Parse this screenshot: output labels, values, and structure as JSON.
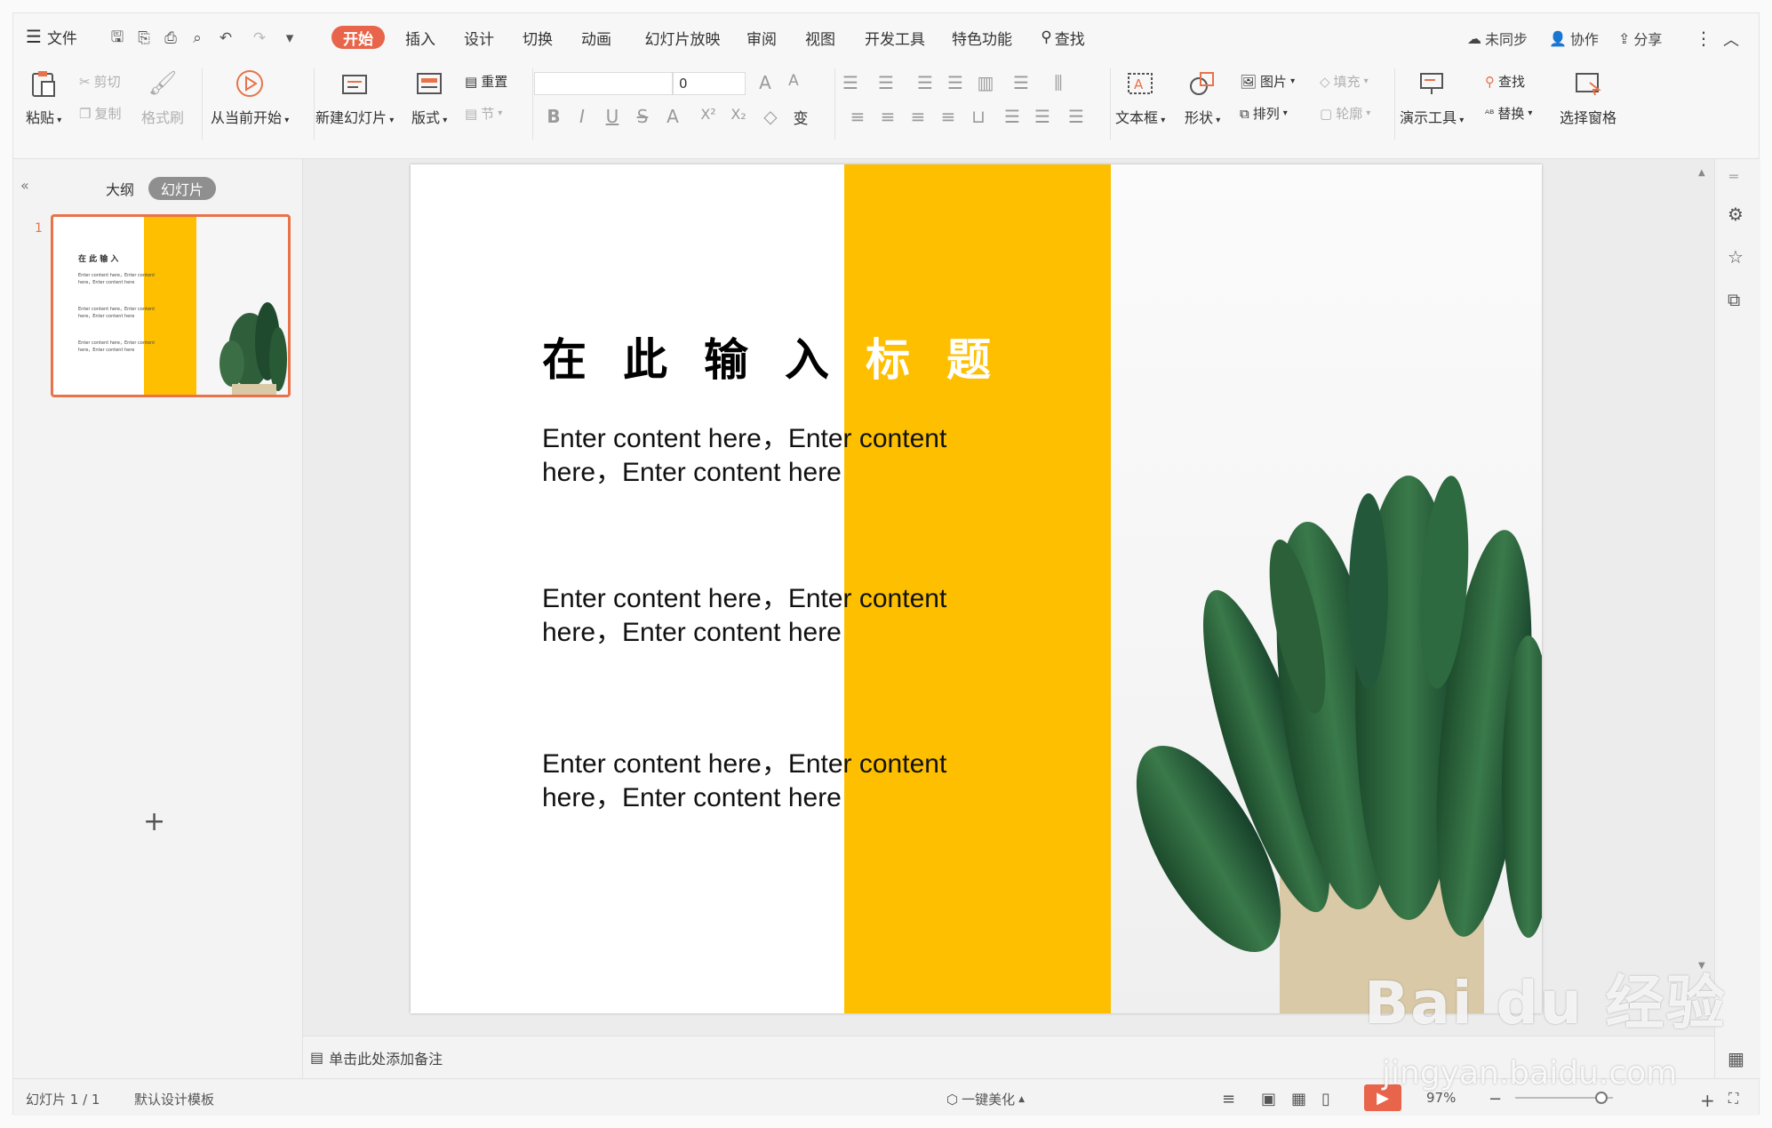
{
  "menu": {
    "file": "文件",
    "tabs": [
      "开始",
      "插入",
      "设计",
      "切换",
      "动画",
      "幻灯片放映",
      "审阅",
      "视图",
      "开发工具",
      "特色功能"
    ],
    "search": "查找",
    "right": {
      "sync": "未同步",
      "collab": "协作",
      "share": "分享"
    }
  },
  "ribbon": {
    "paste": "粘贴",
    "cut": "剪切",
    "copy": "复制",
    "format_painter": "格式刷",
    "play_from_current": "从当前开始",
    "new_slide": "新建幻灯片",
    "layout": "版式",
    "reset": "重置",
    "section": "节",
    "font_size": "0",
    "textbox": "文本框",
    "shape": "形状",
    "picture": "图片",
    "fill": "填充",
    "arrange": "排列",
    "outline": "轮廓",
    "present_tools": "演示工具",
    "find": "查找",
    "replace": "替换",
    "selection_pane": "选择窗格"
  },
  "left_panel": {
    "outline_tab": "大纲",
    "slides_tab": "幻灯片",
    "slide_number": "1",
    "thumb_title_black": "在 此 输 入",
    "thumb_title_white": "标 题",
    "thumb_line_a": "Enter content here，Enter content",
    "thumb_line_b": "here，Enter content here"
  },
  "slide": {
    "title_chars": [
      "在",
      "此",
      "输",
      "入",
      "标",
      "题"
    ],
    "paragraphs": [
      {
        "line1": "Enter content here，Enter content",
        "line2": "here，Enter content here"
      },
      {
        "line1": "Enter content here，Enter content",
        "line2": "here，Enter content here"
      },
      {
        "line1": "Enter content here，Enter content",
        "line2": "here，Enter content here"
      }
    ],
    "accent_color": "#fdbf00"
  },
  "notes": {
    "placeholder": "单击此处添加备注"
  },
  "status": {
    "slide_count": "幻灯片 1 / 1",
    "template": "默认设计模板",
    "beautify": "一键美化",
    "zoom": "97%"
  },
  "watermark": {
    "brand": "Bai du 经验",
    "url": "jingyan.baidu.com"
  },
  "colors": {
    "active_tab": "#e8644a",
    "accent": "#fdbf00",
    "thumb_border": "#e8734a"
  }
}
